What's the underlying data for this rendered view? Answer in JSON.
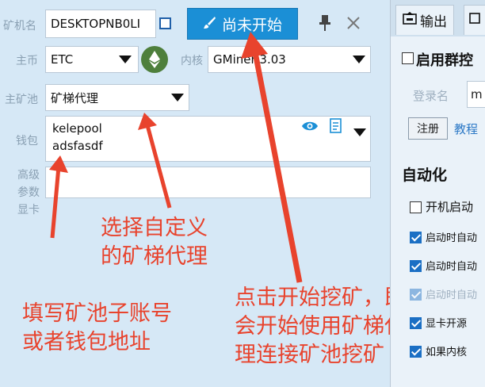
{
  "labels": {
    "miner_name": "矿机名",
    "coin": "主币",
    "kernel": "内核",
    "pool": "主矿池",
    "wallet": "钱包",
    "advanced_1": "高级",
    "advanced_2": "参数",
    "gpu": "显卡"
  },
  "fields": {
    "miner_name_value": "DESKTOPNB0LI",
    "coin_value": "ETC",
    "kernel_value": "GMiner 3.03",
    "pool_value": "矿梯代理",
    "wallet_line1": "kelepool",
    "wallet_line2": "adsfasdf"
  },
  "toolbar": {
    "start_label": "尚未开始"
  },
  "right_panel": {
    "tab_output": "输出",
    "group_control": "启用群控",
    "login_name": "登录名",
    "login_value": "m",
    "register_button": "注册",
    "tutorial_link": "教程",
    "automation_title": "自动化",
    "options": [
      {
        "label": "开机启动",
        "checked": false
      },
      {
        "label": "启动时自动",
        "checked": true
      },
      {
        "label": "启动时自动",
        "checked": true
      },
      {
        "label": "启动时自动",
        "checked": true
      },
      {
        "label": "显卡开源",
        "checked": true
      },
      {
        "label": "如果内核",
        "checked": true
      }
    ]
  },
  "annotations": {
    "pool_hint_1": "选择自定义",
    "pool_hint_2": "的矿梯代理",
    "wallet_hint_1": "填写矿池子账号",
    "wallet_hint_2": "或者钱包地址",
    "start_hint_1": "点击开始挖矿，即",
    "start_hint_2": "会开始使用矿梯代",
    "start_hint_3": "理连接矿池挖矿"
  },
  "colors": {
    "annotation": "#e8432d",
    "accent": "#1b8fd6",
    "panel": "#d6e8f6"
  }
}
